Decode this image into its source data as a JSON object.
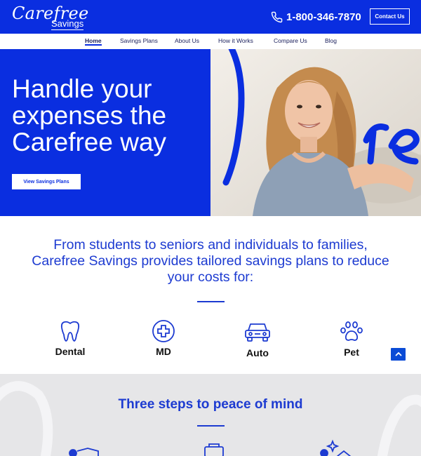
{
  "brand": {
    "script": "Carefree",
    "sub": "Savings"
  },
  "header": {
    "phone": "1-800-346-7870",
    "contact_label": "Contact Us"
  },
  "nav": {
    "items": [
      {
        "label": "Home",
        "active": true
      },
      {
        "label": "Savings Plans",
        "active": false
      },
      {
        "label": "About Us",
        "active": false
      },
      {
        "label": "How it Works",
        "active": false
      },
      {
        "label": "Compare Us",
        "active": false
      },
      {
        "label": "Blog",
        "active": false
      }
    ]
  },
  "hero": {
    "title": "Handle your expenses the Carefree way",
    "button": "View Savings Plans"
  },
  "tagline": "From students to seniors and individuals to families, Carefree Savings provides tailored savings plans to reduce your costs for:",
  "services": [
    {
      "label": "Dental",
      "icon": "tooth-icon"
    },
    {
      "label": "MD",
      "icon": "medical-cross-icon"
    },
    {
      "label": "Auto",
      "icon": "car-icon"
    },
    {
      "label": "Pet",
      "icon": "paw-icon"
    }
  ],
  "steps": {
    "title": "Three steps to peace of mind"
  },
  "colors": {
    "brand_blue": "#0a2ee0",
    "text_blue": "#1d3bd1",
    "steps_bg": "#e6e6e8"
  }
}
